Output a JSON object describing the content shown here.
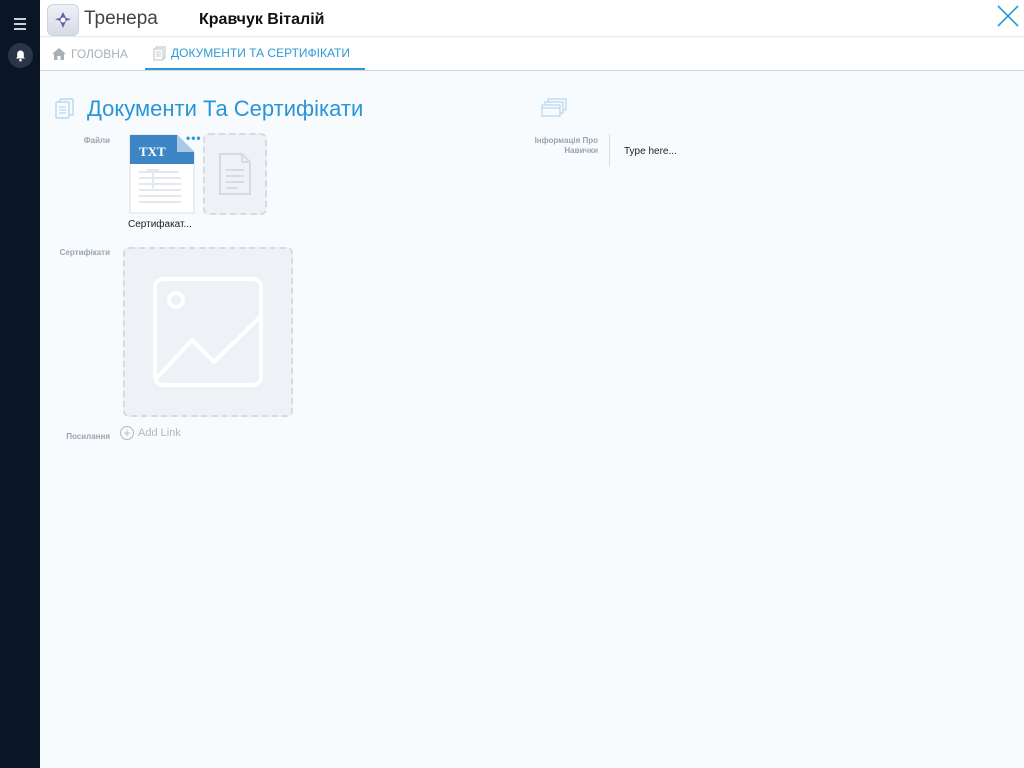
{
  "header": {
    "app_title": "Тренера",
    "user_name": "Кравчук Віталій"
  },
  "tabs": [
    {
      "label": "ГОЛОВНА",
      "icon": "home-icon",
      "active": false
    },
    {
      "label": "ДОКУМЕНТИ ТА СЕРТИФІКАТИ",
      "icon": "document-icon",
      "active": true
    }
  ],
  "section": {
    "title": "Документи Та Сертифікати"
  },
  "fields": {
    "files_label": "Файли",
    "certificates_label": "Сертифікати",
    "links_label": "Посилання",
    "add_link_label": "Add Link",
    "info_label": "Інформація Про Навички",
    "info_placeholder": "Type here..."
  },
  "files": [
    {
      "type_label": "TXT",
      "name": "Сертифакат..."
    }
  ],
  "colors": {
    "accent": "#2d9ad6",
    "sidebar": "#0a1526",
    "background": "#f7fbfe"
  }
}
